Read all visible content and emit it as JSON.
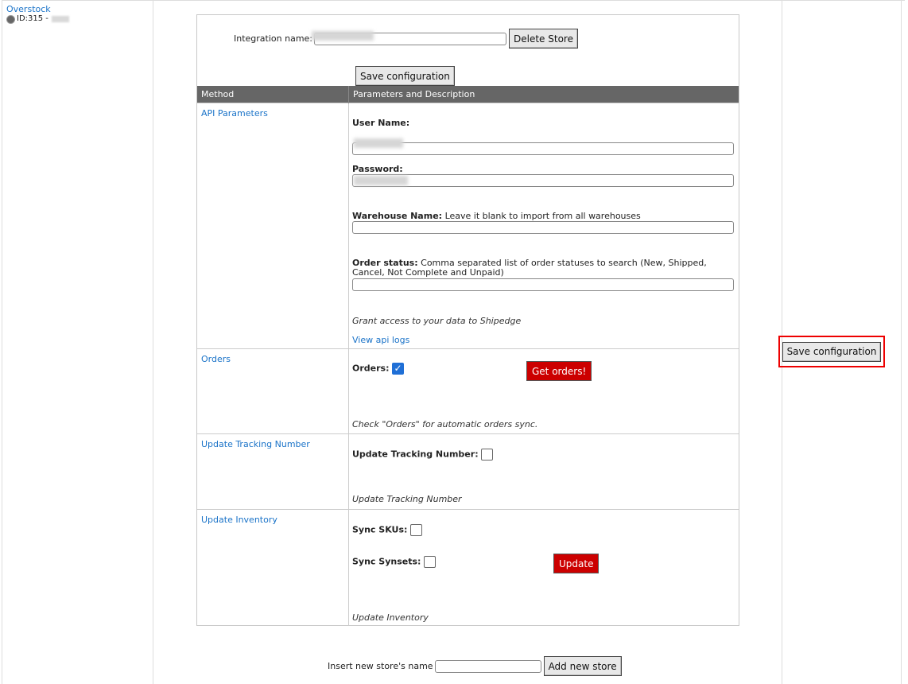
{
  "store": {
    "name": "Overstock",
    "id_label": "ID:315 -"
  },
  "integration": {
    "label": "Integration name:",
    "delete_label": "Delete Store"
  },
  "save_label": "Save configuration",
  "table": {
    "col_method": "Method",
    "col_params": "Parameters and Description"
  },
  "api": {
    "method": "API Parameters",
    "username_label": "User Name:",
    "password_label": "Password:",
    "warehouse_label": "Warehouse Name:",
    "warehouse_desc": "Leave it blank to import from all warehouses",
    "order_status_label": "Order status:",
    "order_status_desc": "Comma separated list of order statuses to search (New, Shipped, Cancel, Not Complete and Unpaid)",
    "grant_text": "Grant access to your data to Shipedge",
    "view_logs": "View api logs"
  },
  "orders": {
    "method": "Orders",
    "label": "Orders:",
    "checked": true,
    "button": "Get orders!",
    "desc": "Check \"Orders\" for automatic orders sync."
  },
  "tracking": {
    "method": "Update Tracking Number",
    "label": "Update Tracking Number:",
    "checked": false,
    "desc": "Update Tracking Number"
  },
  "inventory": {
    "method": "Update Inventory",
    "sync_skus": "Sync SKUs:",
    "sync_synsets": "Sync Synsets:",
    "button": "Update",
    "desc": "Update Inventory"
  },
  "side_save_label": "Save configuration",
  "new_store": {
    "label": "Insert new store's name",
    "button": "Add new store",
    "value": ""
  }
}
